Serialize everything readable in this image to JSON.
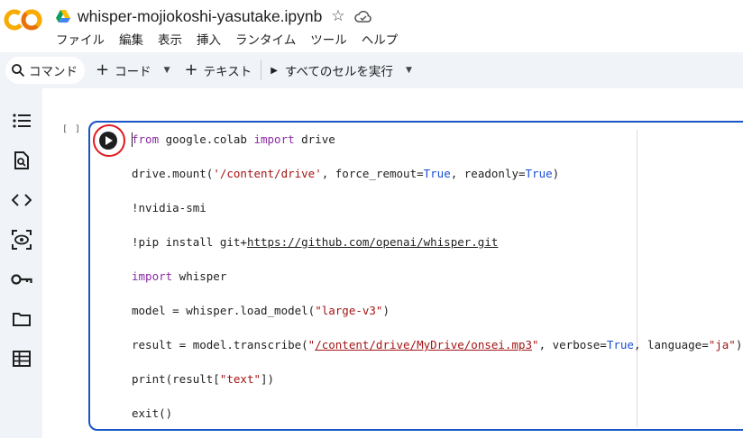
{
  "app": {
    "logo_text": "CO",
    "brand_color": "#f9ab00"
  },
  "notebook": {
    "title": "whisper-mojiokoshi-yasutake.ipynb"
  },
  "menu": [
    "ファイル",
    "編集",
    "表示",
    "挿入",
    "ランタイム",
    "ツール",
    "ヘルプ"
  ],
  "toolbar": {
    "command_label": "コマンド",
    "add_code_label": "コード",
    "add_text_label": "テキスト",
    "run_all_label": "すべてのセルを実行"
  },
  "sidebar": {
    "items": [
      "toc-icon",
      "find-icon",
      "code-snippets-icon",
      "variables-icon",
      "secrets-key-icon",
      "files-folder-icon",
      "data-table-icon"
    ]
  },
  "cell": {
    "exec_count": "[ ]",
    "accent_color": "#1a56c4",
    "code_lines": [
      [
        {
          "t": "from",
          "c": "kw"
        },
        {
          "t": " google.colab "
        },
        {
          "t": "import",
          "c": "kw"
        },
        {
          "t": " drive"
        }
      ],
      [
        {
          "t": "drive.mount("
        },
        {
          "t": "'/content/drive'",
          "c": "str"
        },
        {
          "t": ", force_remout="
        },
        {
          "t": "True",
          "c": "bool"
        },
        {
          "t": ", readonly="
        },
        {
          "t": "True",
          "c": "bool"
        },
        {
          "t": ")"
        }
      ],
      [
        {
          "t": "!nvidia-smi"
        }
      ],
      [
        {
          "t": "!pip install git+"
        },
        {
          "t": "https://github.com/openai/whisper.git",
          "c": "lnk-plain"
        }
      ],
      [
        {
          "t": "import",
          "c": "kw"
        },
        {
          "t": " whisper"
        }
      ],
      [
        {
          "t": "model = whisper.load_model("
        },
        {
          "t": "\"large-v3\"",
          "c": "str"
        },
        {
          "t": ")"
        }
      ],
      [
        {
          "t": "result = model.transcribe("
        },
        {
          "t": "\"",
          "c": "str"
        },
        {
          "t": "/content/drive/MyDrive/onsei.mp3",
          "c": "lnk"
        },
        {
          "t": "\"",
          "c": "str"
        },
        {
          "t": ", verbose="
        },
        {
          "t": "True",
          "c": "bool"
        },
        {
          "t": ", language="
        },
        {
          "t": "\"ja\"",
          "c": "str"
        },
        {
          "t": ")"
        }
      ],
      [
        {
          "t": "print(result["
        },
        {
          "t": "\"text\"",
          "c": "str"
        },
        {
          "t": "])"
        }
      ],
      [
        {
          "t": "exit()"
        }
      ]
    ]
  }
}
